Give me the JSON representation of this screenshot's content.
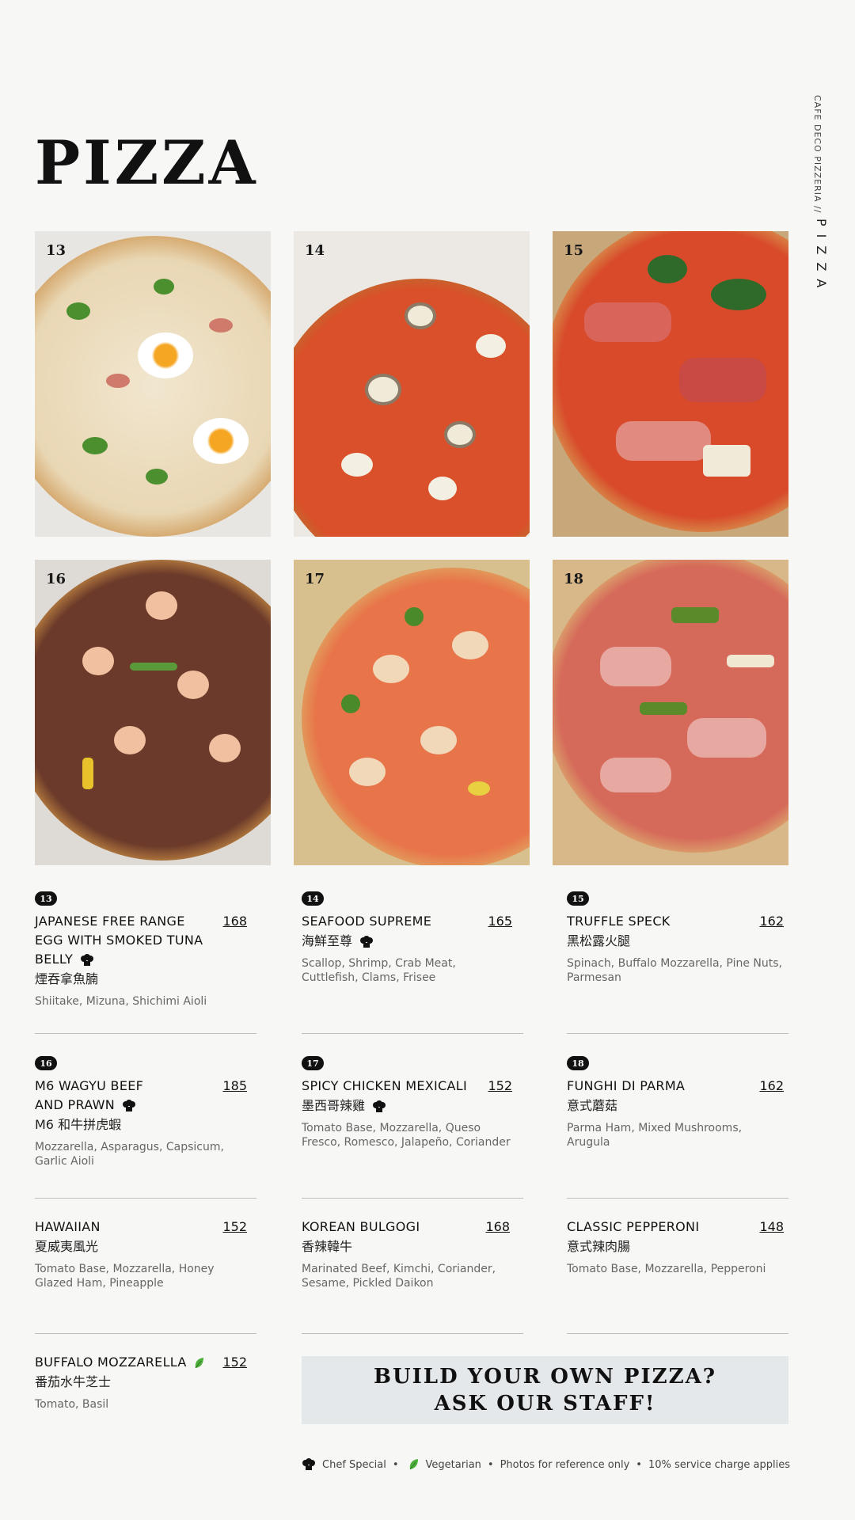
{
  "header": {
    "title": "PIZZA",
    "side_label": "CAFE DECO PIZZERIA //",
    "side_label_2": "PIZZA"
  },
  "photos": [
    {
      "num": "13"
    },
    {
      "num": "14"
    },
    {
      "num": "15"
    },
    {
      "num": "16"
    },
    {
      "num": "17"
    },
    {
      "num": "18"
    }
  ],
  "items": [
    {
      "badge": "13",
      "name": "JAPANESE FREE RANGE EGG WITH SMOKED TUNA BELLY",
      "price": "168",
      "zh": "煙吞拿魚腩",
      "desc": "Shiitake, Mizuna, Shichimi Aioli",
      "chef": true
    },
    {
      "badge": "14",
      "name": "SEAFOOD SUPREME",
      "price": "165",
      "zh": "海鮮至尊",
      "desc": "Scallop, Shrimp, Crab Meat, Cuttlefish, Clams, Frisee",
      "chef": true
    },
    {
      "badge": "15",
      "name": "TRUFFLE SPECK",
      "price": "162",
      "zh": "黑松露火腿",
      "desc": "Spinach, Buffalo Mozzarella, Pine Nuts, Parmesan",
      "chef": false
    },
    {
      "badge": "16",
      "name": "M6 WAGYU BEEF AND PRAWN",
      "price": "185",
      "zh": "M6 和牛拼虎蝦",
      "desc": "Mozzarella, Asparagus, Capsicum, Garlic Aioli",
      "chef": true
    },
    {
      "badge": "17",
      "name": "SPICY CHICKEN MEXICALI",
      "price": "152",
      "zh": "墨西哥辣雞",
      "desc": "Tomato Base, Mozzarella, Queso Fresco, Romesco, Jalapeño, Coriander",
      "chef": true
    },
    {
      "badge": "18",
      "name": "FUNGHI DI PARMA",
      "price": "162",
      "zh": "意式蘑菇",
      "desc": "Parma Ham, Mixed Mushrooms, Arugula",
      "chef": false
    },
    {
      "name": "HAWAIIAN",
      "price": "152",
      "zh": "夏威夷風光",
      "desc": "Tomato Base, Mozzarella, Honey Glazed Ham, Pineapple"
    },
    {
      "name": "KOREAN BULGOGI",
      "price": "168",
      "zh": "香辣韓牛",
      "desc": "Marinated Beef, Kimchi, Coriander, Sesame, Pickled Daikon"
    },
    {
      "name": "CLASSIC PEPPERONI",
      "price": "148",
      "zh": "意式辣肉腸",
      "desc": "Tomato Base, Mozzarella, Pepperoni"
    },
    {
      "name": "BUFFALO MOZZARELLA",
      "price": "152",
      "zh": "番茄水牛芝士",
      "desc": "Tomato, Basil",
      "veg": true
    }
  ],
  "cta": {
    "line1": "BUILD YOUR OWN PIZZA?",
    "line2": "ASK OUR STAFF!"
  },
  "legend": {
    "chef": "Chef Special",
    "veg": "Vegetarian",
    "photos": "Photos for reference only",
    "service": "10% service charge applies"
  },
  "colors": {
    "background": "#f7f7f5",
    "cta_bg": "#e4e8ea",
    "veg_green": "#4caf3a"
  }
}
